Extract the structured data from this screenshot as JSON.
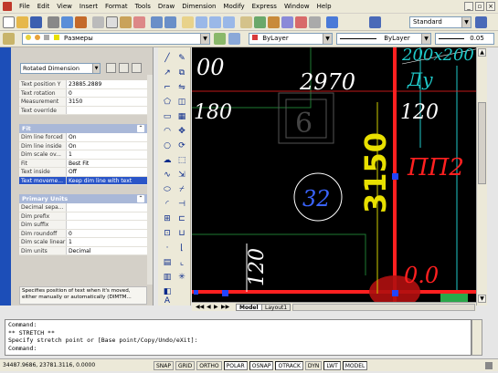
{
  "menu": [
    "File",
    "Edit",
    "View",
    "Insert",
    "Format",
    "Tools",
    "Draw",
    "Dimension",
    "Modify",
    "Express",
    "Window",
    "Help"
  ],
  "toolbar": {
    "text_style": "Standard",
    "layer": "Размеры",
    "color": "ByLayer",
    "linetype": "ByLayer",
    "lineweight": "0.05"
  },
  "properties": {
    "object_type": "Rotated Dimension",
    "rows_top": [
      {
        "k": "Text position Y",
        "v": "23885.2889"
      },
      {
        "k": "Text rotation",
        "v": "0"
      },
      {
        "k": "Measurement",
        "v": "3150"
      },
      {
        "k": "Text override",
        "v": ""
      }
    ],
    "fit_header": "Fit",
    "rows_fit": [
      {
        "k": "Dim line forced",
        "v": "On"
      },
      {
        "k": "Dim line inside",
        "v": "On"
      },
      {
        "k": "Dim scale ov...",
        "v": "1"
      },
      {
        "k": "Fit",
        "v": "Best Fit"
      },
      {
        "k": "Text inside",
        "v": "Off"
      },
      {
        "k": "Text moveme...",
        "v": "Keep dim line with text"
      }
    ],
    "primary_header": "Primary Units",
    "rows_primary": [
      {
        "k": "Decimal sepa...",
        "v": ""
      },
      {
        "k": "Dim prefix",
        "v": ""
      },
      {
        "k": "Dim suffix",
        "v": ""
      },
      {
        "k": "Dim roundoff",
        "v": "0"
      },
      {
        "k": "Dim scale linear",
        "v": "1"
      },
      {
        "k": "Dim units",
        "v": "Decimal"
      }
    ],
    "description": "Specifies position of text when it's moved, either manually or automatically (DIMTM..."
  },
  "drawing": {
    "texts": [
      "00",
      "2970",
      "180",
      "6",
      "120",
      "200x200",
      "Ду",
      "3150",
      "ПП2",
      "32",
      "120",
      "0.0"
    ]
  },
  "tabs": [
    "Model",
    "Layout1"
  ],
  "command": {
    "lines": [
      "Command:",
      "** STRETCH **",
      "Specify stretch point or [Base point/Copy/Undo/eXit]:",
      "Command:"
    ]
  },
  "status": {
    "coords": "34487.9686, 23781.3116, 0.0000",
    "buttons": [
      "SNAP",
      "GRID",
      "ORTHO",
      "POLAR",
      "OSNAP",
      "OTRACK",
      "DYN",
      "LWT",
      "MODEL"
    ],
    "active": [
      "POLAR",
      "OSNAP",
      "OTRACK",
      "LWT",
      "MODEL"
    ]
  },
  "colors": {
    "canvas_bg": "#000000",
    "red_line": "#ff2020",
    "dim_yellow": "#e8e000",
    "dim_white": "#ffffff",
    "cyan": "#1fc8c8",
    "blue_text": "#3a64ff",
    "green": "#1e7a32",
    "selection": "#2a55c8"
  }
}
